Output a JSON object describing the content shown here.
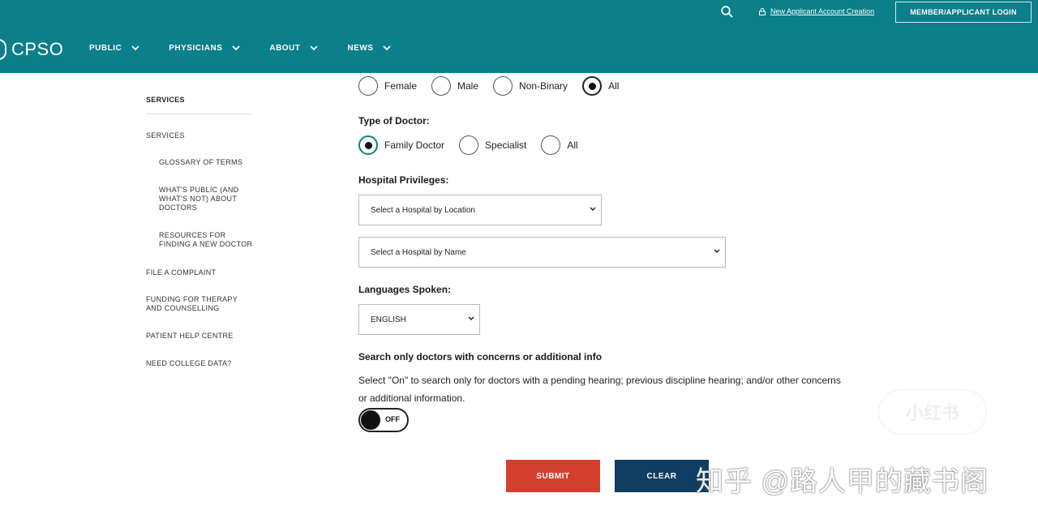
{
  "header": {
    "logo": "CPSO",
    "nav": [
      "PUBLIC",
      "PHYSICIANS",
      "ABOUT",
      "NEWS"
    ],
    "account_link": "New Applicant Account Creation",
    "login_button": "MEMBER/APPLICANT LOGIN"
  },
  "sidebar": {
    "heading": "SERVICES",
    "items": [
      {
        "label": "SERVICES",
        "sub": false
      },
      {
        "label": "GLOSSARY OF TERMS",
        "sub": true
      },
      {
        "label": "WHAT'S PUBLIC (AND WHAT'S NOT) ABOUT DOCTORS",
        "sub": true
      },
      {
        "label": "RESOURCES FOR FINDING A NEW DOCTOR",
        "sub": true
      },
      {
        "label": "FILE A COMPLAINT",
        "sub": false
      },
      {
        "label": "FUNDING FOR THERAPY AND COUNSELLING",
        "sub": false
      },
      {
        "label": "PATIENT HELP CENTRE",
        "sub": false
      },
      {
        "label": "NEED COLLEGE DATA?",
        "sub": false
      }
    ]
  },
  "form": {
    "gender_options": [
      "Female",
      "Male",
      "Non-Binary",
      "All"
    ],
    "gender_selected": "All",
    "doctor_type_label": "Type of Doctor:",
    "doctor_type_options": [
      "Family Doctor",
      "Specialist",
      "All"
    ],
    "doctor_type_selected": "Family Doctor",
    "hospital_label": "Hospital Privileges:",
    "hospital_location": "Select a Hospital by Location",
    "hospital_name": "Select a Hospital by Name",
    "languages_label": "Languages Spoken:",
    "language_selected": "ENGLISH",
    "concerns_label": "Search only doctors with concerns or additional info",
    "concerns_description": "Select \"On\" to search only for doctors with a pending hearing; previous discipline hearing; and/or other concerns or additional information.",
    "toggle_state": "OFF",
    "submit_label": "SUBMIT",
    "clear_label": "CLEAR"
  },
  "overlay": {
    "watermark": "知乎 @路人甲的藏书阁",
    "badge": "小红书"
  },
  "colors": {
    "header": "#0b7f8a",
    "submit": "#d23f2f",
    "clear": "#0f3e62"
  }
}
